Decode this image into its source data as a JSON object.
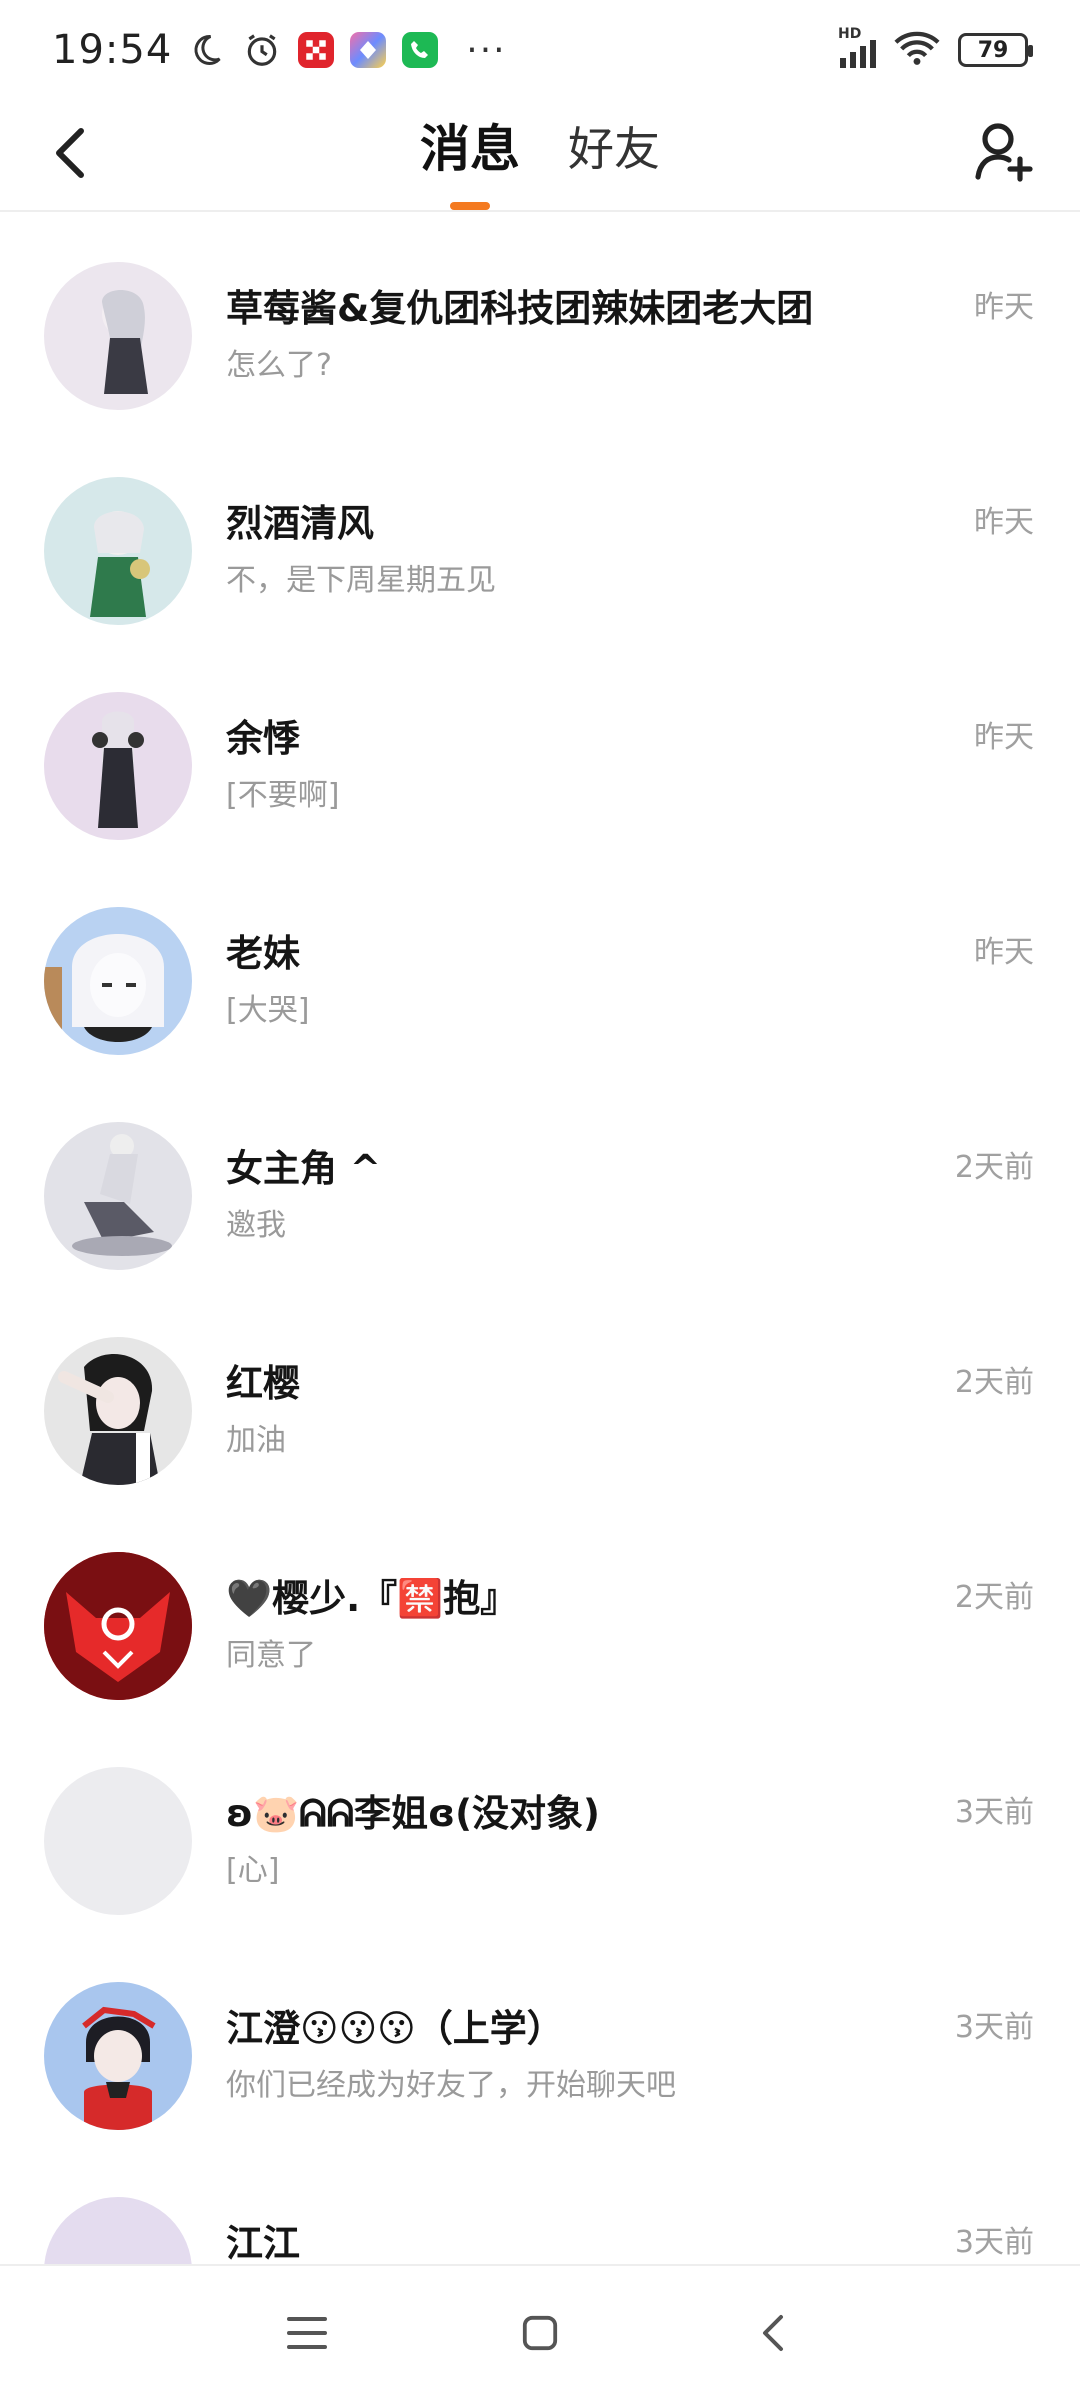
{
  "status_bar": {
    "time": "19:54",
    "battery": "79",
    "network_label": "HD",
    "more": "···"
  },
  "header": {
    "tabs": [
      {
        "label": "消息",
        "active": true
      },
      {
        "label": "好友",
        "active": false
      }
    ],
    "accent_color": "#f47a20"
  },
  "conversations": [
    {
      "name": "草莓酱&复仇团科技团辣妹团老大团",
      "preview": "怎么了?",
      "time": "昨天",
      "avatar_color": "#ece6ee"
    },
    {
      "name": "烈酒清风",
      "preview": "不，是下周星期五见",
      "time": "昨天",
      "avatar_color": "#d6e8ea"
    },
    {
      "name": "余悸",
      "preview": "[不要啊]",
      "time": "昨天",
      "avatar_color": "#e8dcec"
    },
    {
      "name": "老妹",
      "preview": "[大哭]",
      "time": "昨天",
      "avatar_color": "#b9d2f2"
    },
    {
      "name": "女主角 ^",
      "preview": "邀我",
      "time": "2天前",
      "avatar_color": "#e2e2e8"
    },
    {
      "name": "红樱",
      "preview": "加油",
      "time": "2天前",
      "avatar_color": "#e6e6e6"
    },
    {
      "name": "🖤樱少.『🈲抱』",
      "preview": "同意了",
      "time": "2天前",
      "avatar_color": "#d42a2a"
    },
    {
      "name": "ʚ🐷ᕱᕱ李姐ɞ(没对象)",
      "preview": "[心]",
      "time": "3天前",
      "avatar_color": "#ececef"
    },
    {
      "name": "江澄😗😗😗（上学）",
      "preview": "你们已经成为好友了，开始聊天吧",
      "time": "3天前",
      "avatar_color": "#a9c6ee"
    },
    {
      "name": "江江",
      "preview": "",
      "time": "3天前",
      "avatar_color": "#e4dcef"
    }
  ],
  "icons": {
    "back": "chevron-left-icon",
    "add_friend": "add-user-icon",
    "menu": "menu-icon",
    "home": "home-icon",
    "nav_back": "back-icon"
  }
}
